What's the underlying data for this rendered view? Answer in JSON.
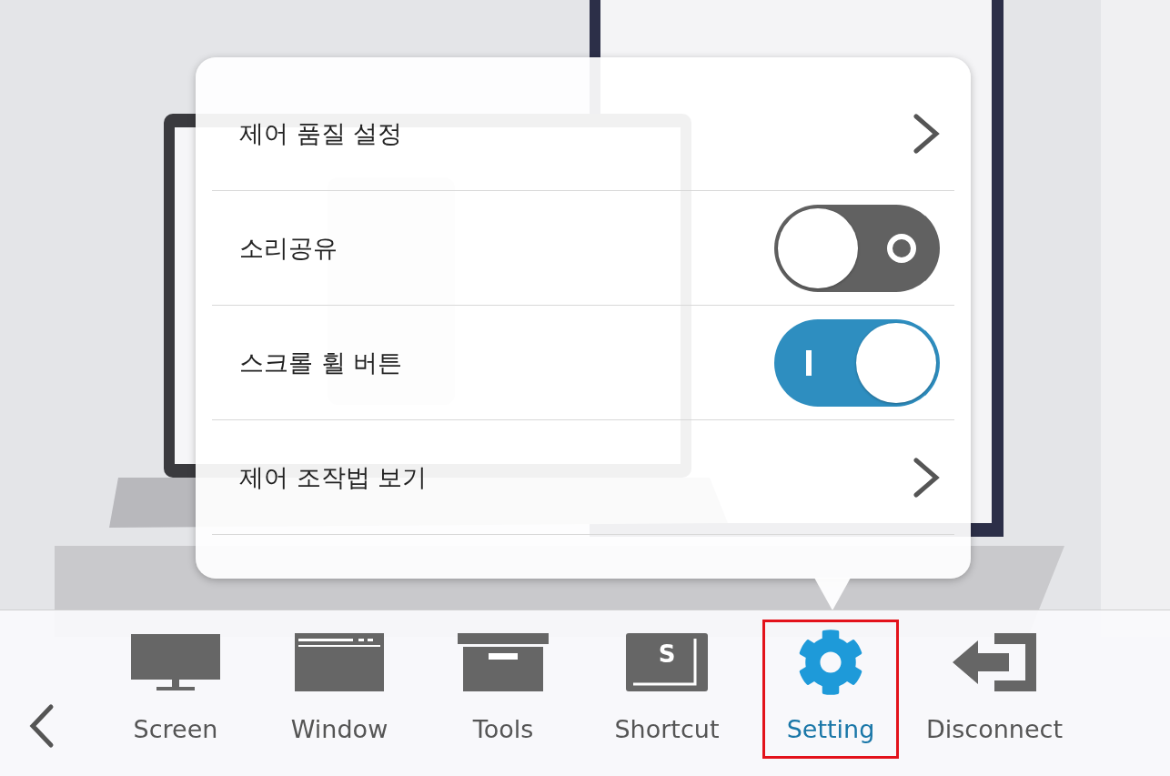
{
  "menu": {
    "items": [
      {
        "kind": "link",
        "label": "제어 품질 설정"
      },
      {
        "kind": "toggle",
        "label": "소리공유",
        "on": false
      },
      {
        "kind": "toggle",
        "label": "스크롤 휠 버튼",
        "on": true
      },
      {
        "kind": "link",
        "label": "제어 조작법 보기"
      }
    ]
  },
  "toolbar": {
    "items": [
      {
        "kind": "screen",
        "label": "Screen",
        "selected": false
      },
      {
        "kind": "window",
        "label": "Window",
        "selected": false
      },
      {
        "kind": "tools",
        "label": "Tools",
        "selected": false
      },
      {
        "kind": "shortcut",
        "label": "Shortcut",
        "selected": false,
        "key_label": "S"
      },
      {
        "kind": "setting",
        "label": "Setting",
        "selected": true
      },
      {
        "kind": "disconnect",
        "label": "Disconnect",
        "selected": false
      }
    ]
  }
}
